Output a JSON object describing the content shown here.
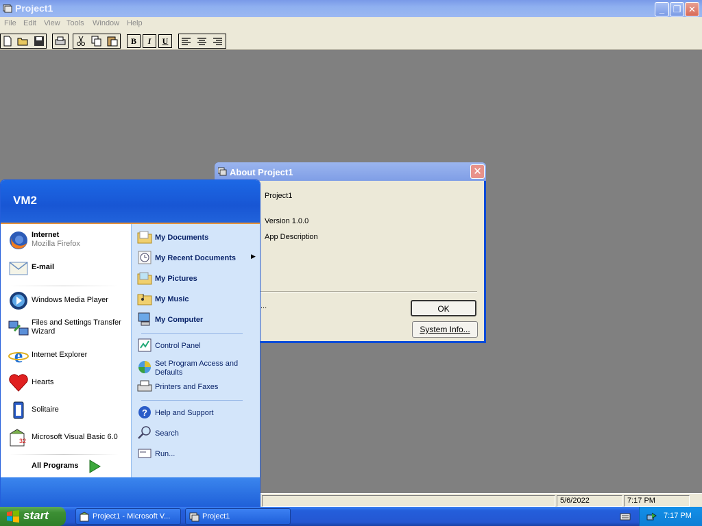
{
  "window": {
    "title": "Project1",
    "menu": [
      "File",
      "Edit",
      "View",
      "Tools",
      "Window",
      "Help"
    ]
  },
  "toolbar": {
    "bold": "B",
    "italic": "I",
    "underline": "U"
  },
  "statusbar": {
    "date": "5/6/2022",
    "time": "7:17 PM"
  },
  "about_dialog": {
    "title": "About Project1",
    "app_name": "Project1",
    "version": "Version 1.0.0",
    "description": "App Description",
    "warning_text": "...",
    "ok_label": "OK",
    "sysinfo_label": "System Info..."
  },
  "start_menu": {
    "user": "VM2",
    "pinned": [
      {
        "title": "Internet",
        "subtitle": "Mozilla Firefox",
        "icon": "firefox-icon"
      },
      {
        "title": "E-mail",
        "icon": "email-icon"
      }
    ],
    "recent": [
      {
        "label": "Windows Media Player",
        "icon": "media-player-icon"
      },
      {
        "label": "Files and Settings Transfer Wizard",
        "icon": "transfer-wizard-icon"
      },
      {
        "label": "Internet Explorer",
        "icon": "internet-explorer-icon"
      },
      {
        "label": "Hearts",
        "icon": "hearts-icon"
      },
      {
        "label": "Solitaire",
        "icon": "solitaire-icon"
      },
      {
        "label": "Microsoft Visual Basic 6.0",
        "icon": "visual-basic-icon"
      }
    ],
    "all_programs": "All Programs",
    "places": [
      {
        "label": "My Documents",
        "icon": "folder-icon"
      },
      {
        "label": "My Recent Documents",
        "icon": "recent-documents-icon"
      },
      {
        "label": "My Pictures",
        "icon": "folder-icon"
      },
      {
        "label": "My Music",
        "icon": "folder-icon"
      },
      {
        "label": "My Computer",
        "icon": "computer-icon"
      }
    ],
    "settings": [
      {
        "label": "Control Panel",
        "icon": "control-panel-icon"
      },
      {
        "label": "Set Program Access and Defaults",
        "icon": "program-access-icon"
      },
      {
        "label": "Printers and Faxes",
        "icon": "printer-icon"
      }
    ],
    "help": [
      {
        "label": "Help and Support",
        "icon": "help-icon"
      },
      {
        "label": "Search",
        "icon": "search-icon"
      },
      {
        "label": "Run...",
        "icon": "run-icon"
      }
    ]
  },
  "taskbar": {
    "start_label": "start",
    "tasks": [
      "Project1 - Microsoft V...",
      "Project1"
    ],
    "clock": "7:17 PM"
  }
}
